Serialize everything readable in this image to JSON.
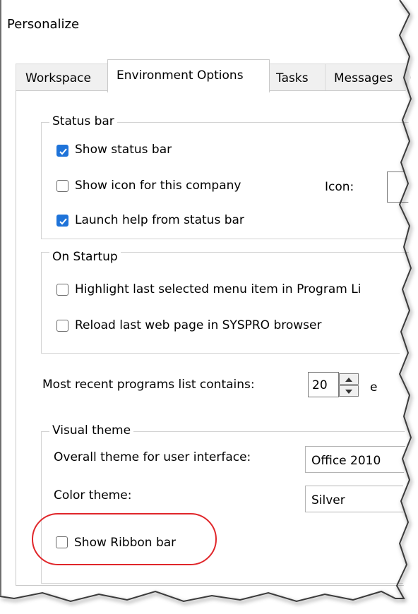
{
  "window": {
    "title": "Personalize"
  },
  "tabs": [
    {
      "label": "Workspace",
      "active": false
    },
    {
      "label": "Environment Options",
      "active": true
    },
    {
      "label": "Tasks",
      "active": false
    },
    {
      "label": "Messages",
      "active": false
    }
  ],
  "status_bar": {
    "legend": "Status bar",
    "show_status_bar": {
      "label": "Show status bar",
      "checked": true
    },
    "show_icon": {
      "label": "Show icon for this company",
      "checked": false
    },
    "icon_label": "Icon:",
    "launch_help": {
      "label": "Launch help from status bar",
      "checked": true
    }
  },
  "on_startup": {
    "legend": "On Startup",
    "highlight_last": {
      "label": "Highlight last selected menu item in Program Li",
      "checked": false
    },
    "reload_web": {
      "label": "Reload last web page in SYSPRO browser",
      "checked": false
    }
  },
  "recent": {
    "label": "Most recent programs list contains:",
    "value": "20",
    "suffix": "e"
  },
  "visual_theme": {
    "legend": "Visual theme",
    "overall_label": "Overall theme for user interface:",
    "overall_value": "Office 2010",
    "color_label": "Color theme:",
    "color_value": "Silver",
    "ribbon": {
      "label": "Show Ribbon bar",
      "checked": false
    }
  },
  "colors": {
    "accent": "#1e73d9",
    "highlight": "#e0262a"
  }
}
